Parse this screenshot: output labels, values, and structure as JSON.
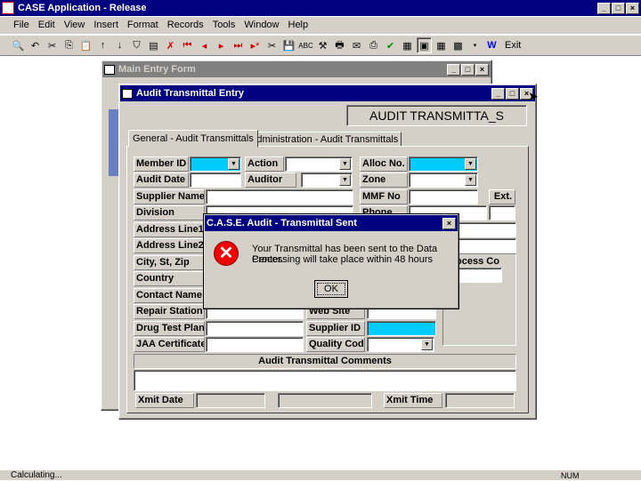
{
  "app": {
    "title": "CASE Application - Release"
  },
  "menu": [
    "File",
    "Edit",
    "View",
    "Insert",
    "Format",
    "Records",
    "Tools",
    "Window",
    "Help"
  ],
  "toolbar": {
    "exit_label": "Exit"
  },
  "main_form": {
    "title": "Main Entry Form"
  },
  "audit_window": {
    "title": "Audit Transmittal Entry",
    "banner": "AUDIT TRANSMITTA_S",
    "tabs": [
      "General - Audit Transmittals",
      "Administration - Audit Transmittals"
    ]
  },
  "fields": {
    "member_id": "Member ID",
    "action": "Action",
    "alloc_no": "Alloc No.",
    "audit_date": "Audit Date",
    "auditor": "Auditor",
    "zone": "Zone",
    "supplier_name": "Supplier Name",
    "mmf_no": "MMF No",
    "ext": "Ext.",
    "division": "Division",
    "phone": "Phone",
    "address1": "Address Line1",
    "address2": "Address Line2",
    "city": "City, St, Zip",
    "process_co": "ocess Co",
    "country": "Country",
    "contact": "Contact Name",
    "repair": "Repair Station",
    "website": "Web Site",
    "drug": "Drug Test Plan",
    "supplier_id": "Supplier ID",
    "jaa": "JAA Certificate",
    "quality": "Quality Code",
    "comments_header": "Audit Transmittal Comments",
    "xmit_date": "Xmit Date",
    "xmit_time": "Xmit Time"
  },
  "dialog": {
    "title": "C.A.S.E. Audit - Transmittal Sent",
    "line1": "Your Transmittal has been sent to the Data Center.",
    "line2": "Processing will take place within 48 hours",
    "ok": "OK"
  },
  "status": {
    "text": "Calculating...",
    "num": "NUM"
  }
}
